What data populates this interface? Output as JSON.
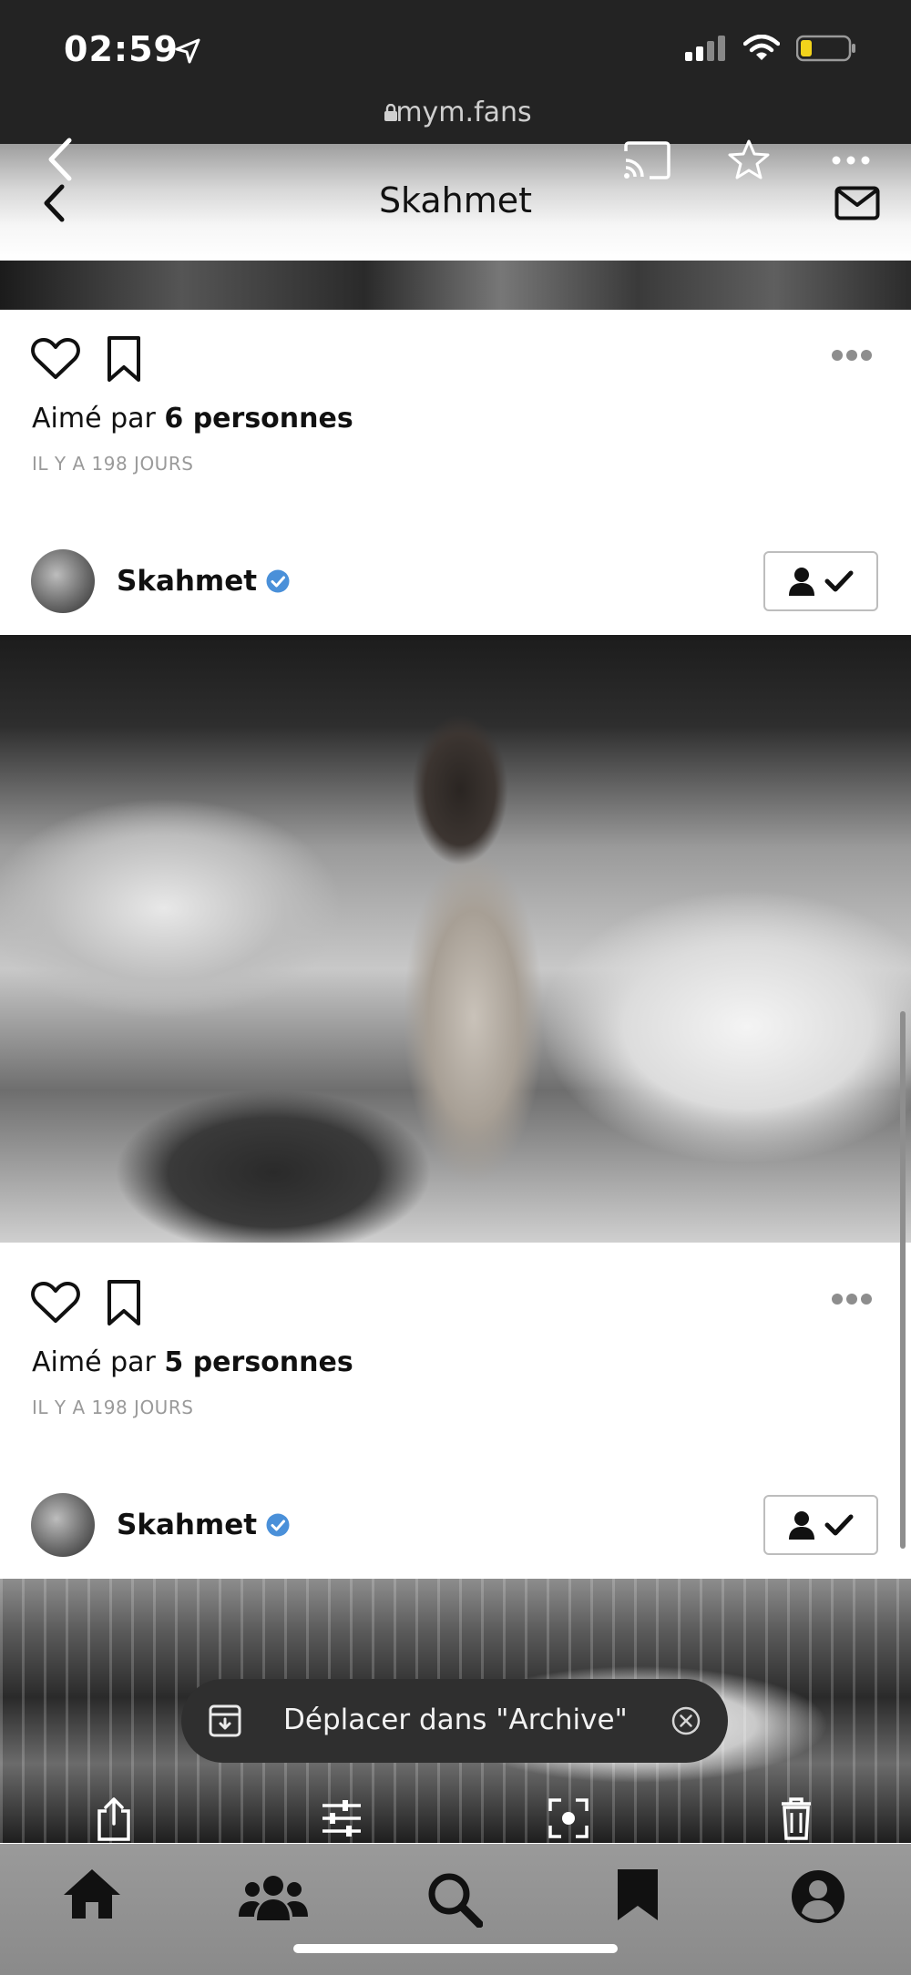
{
  "status_bar": {
    "time": "02:59",
    "url": "mym.fans"
  },
  "header": {
    "title": "Skahmet"
  },
  "posts": [
    {
      "likes_prefix": "Aimé par",
      "likes_count_text": "6 personnes",
      "time_ago": "IL Y A 198 JOURS"
    },
    {
      "author": "Skahmet",
      "likes_prefix": "Aimé par",
      "likes_count_text": "5 personnes",
      "time_ago": "IL Y A 198 JOURS"
    },
    {
      "author": "Skahmet"
    }
  ],
  "toast": {
    "text": "Déplacer dans \"Archive\""
  },
  "tabbar": {
    "items": [
      "home-icon",
      "people-icon",
      "search-icon",
      "bookmark-icon",
      "account-icon"
    ]
  },
  "colors": {
    "verified": "#4a90d9",
    "status_bar_bg": "#232323",
    "toast_bg": "#2f2f2f",
    "tabbar_bg": "#8a8a8a"
  }
}
